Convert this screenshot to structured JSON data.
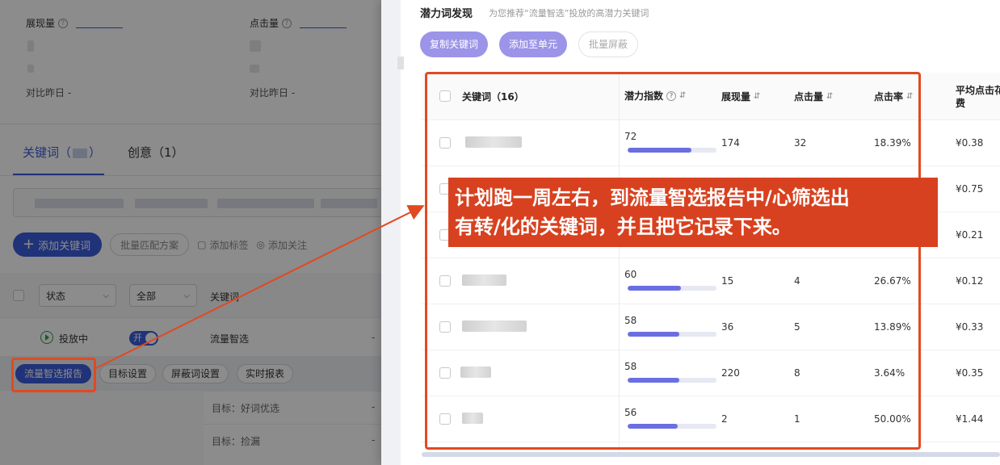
{
  "left": {
    "stats": [
      {
        "label": "展现量",
        "compare": "对比昨日 -"
      },
      {
        "label": "点击量",
        "compare": "对比昨日 -"
      }
    ],
    "tabs": [
      {
        "label": "关键词（",
        "suffix": "）"
      },
      {
        "label": "创意（1）"
      }
    ],
    "toolbar": {
      "add_keyword": "添加关键词",
      "batch_match": "批量匹配方案",
      "add_tag": "添加标签",
      "add_follow": "添加关注"
    },
    "table_head": {
      "status_select": "状态",
      "all_select": "全部",
      "keyword_col": "关键词"
    },
    "row": {
      "status": "投放中",
      "toggle": "开",
      "keyword": "流量智选",
      "dash": "-"
    },
    "subbar_chips": [
      "流量智选报告",
      "目标设置",
      "屏蔽词设置",
      "实时报表"
    ],
    "goals": [
      {
        "text": "目标：好词优选",
        "dash": "-"
      },
      {
        "text": "目标：捡漏",
        "dash": "-"
      }
    ]
  },
  "drawer": {
    "title": "潜力词发现",
    "subtitle": "为您推荐“流量智选”投放的高潜力关键词",
    "buttons": {
      "copy": "复制关键词",
      "add_unit": "添加至单元",
      "batch_block": "批量屏蔽"
    },
    "columns": {
      "keyword": "关键词（16）",
      "potential": "潜力指数",
      "impressions": "展现量",
      "clicks": "点击量",
      "ctr": "点击率",
      "cpc_line1": "平均点击花",
      "cpc_line2": "费"
    },
    "rows": [
      {
        "potential_label": "72",
        "potential": 72,
        "impressions": "174",
        "clicks": "32",
        "ctr": "18.39%",
        "cpc": "¥0.38"
      },
      {
        "potential_label": "",
        "potential": null,
        "impressions": "",
        "clicks": "",
        "ctr": "",
        "cpc": "¥0.75"
      },
      {
        "potential_label": "",
        "potential": null,
        "impressions": "",
        "clicks": "",
        "ctr": "",
        "cpc": "¥0.21"
      },
      {
        "potential_label": "60",
        "potential": 60,
        "impressions": "15",
        "clicks": "4",
        "ctr": "26.67%",
        "cpc": "¥0.12"
      },
      {
        "potential_label": "58",
        "potential": 58,
        "impressions": "36",
        "clicks": "5",
        "ctr": "13.89%",
        "cpc": "¥0.33"
      },
      {
        "potential_label": "58",
        "potential": 58,
        "impressions": "220",
        "clicks": "8",
        "ctr": "3.64%",
        "cpc": "¥0.35"
      },
      {
        "potential_label": "56",
        "potential": 56,
        "impressions": "2",
        "clicks": "1",
        "ctr": "50.00%",
        "cpc": "¥1.44"
      }
    ]
  },
  "callout": {
    "line1": "计划跑一周左右，到流量智选报告中/心筛选出",
    "line2": "有转/化的关键词，并且把它记录下来。"
  },
  "colors": {
    "accent": "#3b5bdb",
    "annotation": "#d8411f",
    "potential_bar": "#6a6fe0",
    "drawer_button": "#9b94e8"
  }
}
